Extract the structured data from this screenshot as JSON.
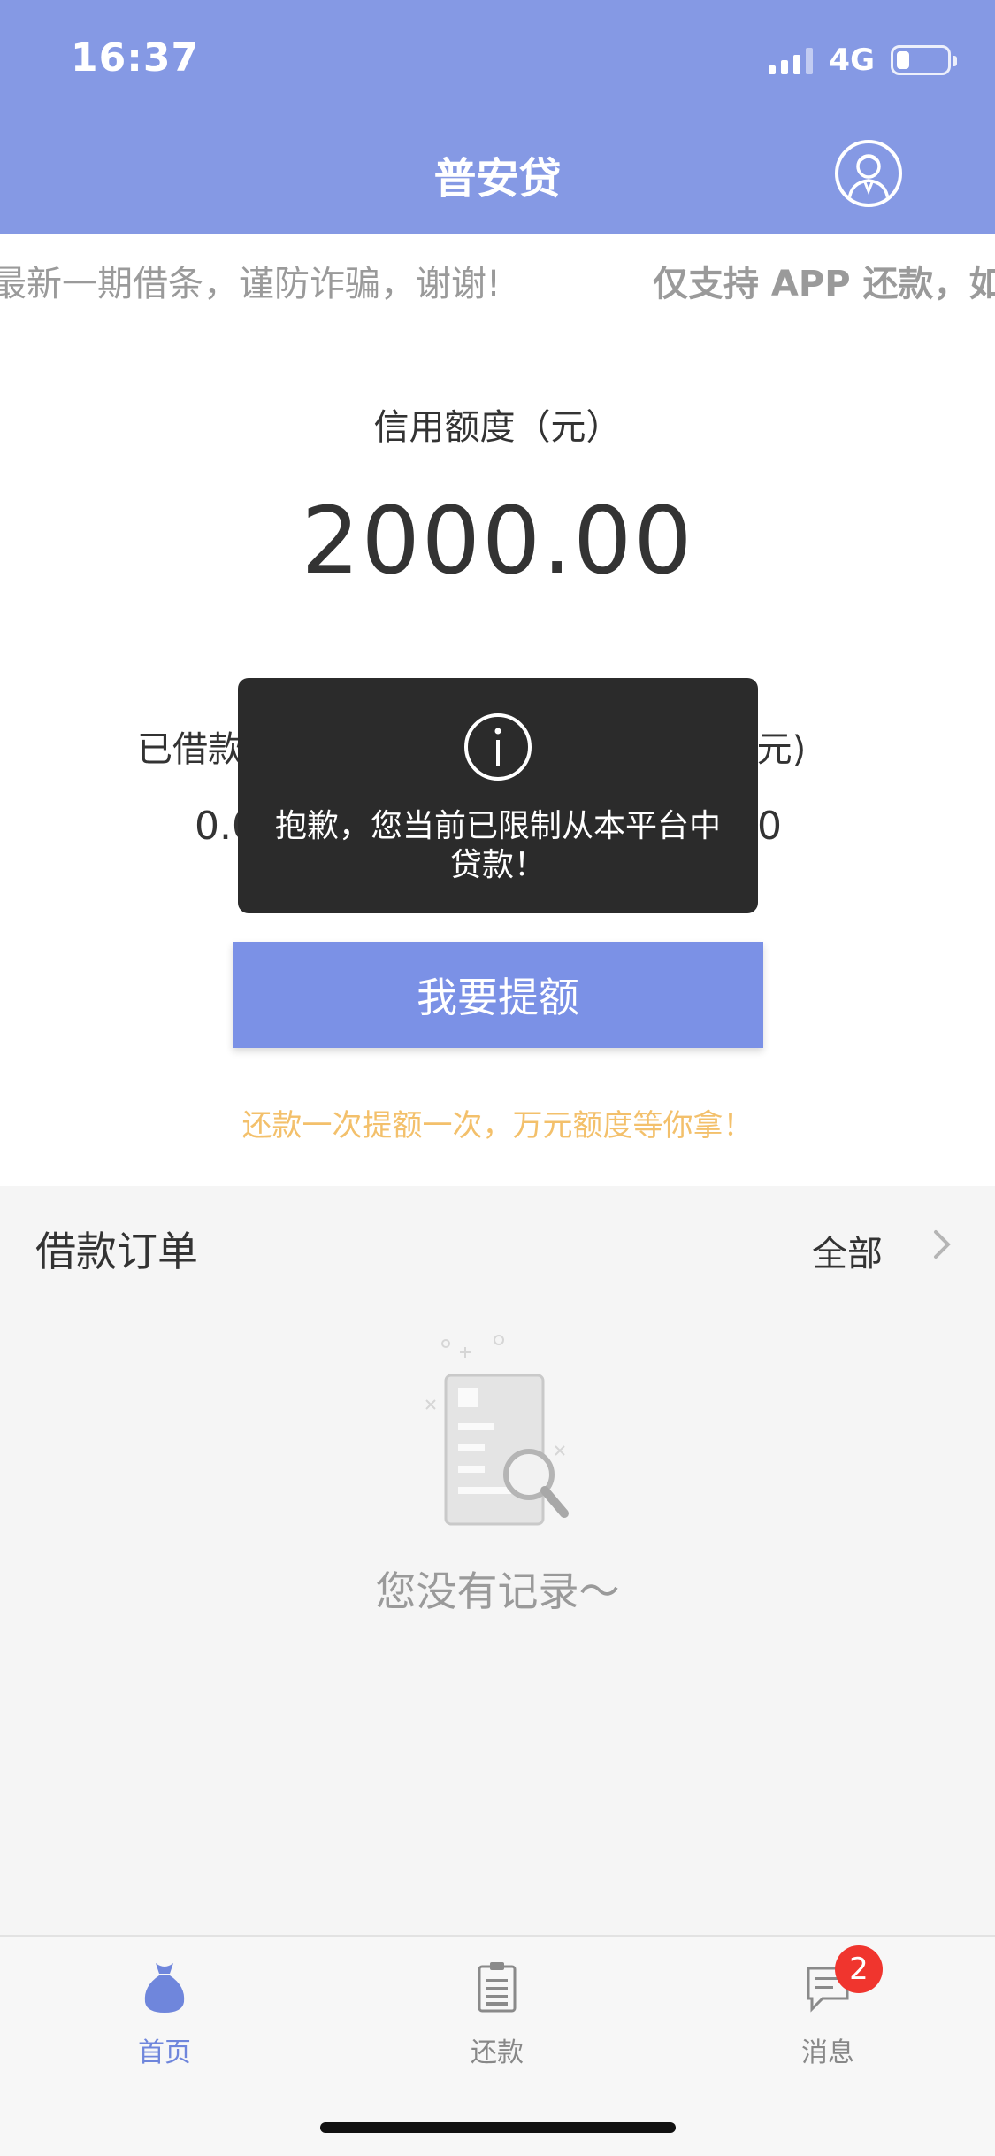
{
  "status_bar": {
    "time": "16:37",
    "network": "4G"
  },
  "header": {
    "title": "普安贷"
  },
  "marquee": {
    "text_1": "最新一期借条，谨防诈骗，谢谢!",
    "text_2": "仅支持 APP 还款，如"
  },
  "credit": {
    "label": "信用额度（元）",
    "amount": "2000.00",
    "borrowed_label": "已借款",
    "borrowed_value": "0.0",
    "right_label": "(元)",
    "right_value": "0",
    "raise_button": "我要提额",
    "promo": "还款一次提额一次，万元额度等你拿！"
  },
  "toast": {
    "message": "抱歉，您当前已限制从本平台中贷款！"
  },
  "orders": {
    "title": "借款订单",
    "all_label": "全部",
    "empty_text": "您没有记录～"
  },
  "tabbar": {
    "tabs": [
      {
        "label": "首页",
        "icon": "money-bag-icon",
        "active": true
      },
      {
        "label": "还款",
        "icon": "clipboard-icon",
        "active": false
      },
      {
        "label": "消息",
        "icon": "message-icon",
        "active": false
      }
    ],
    "message_badge": "2"
  },
  "colors": {
    "header_bg": "#8599e4",
    "button_bg": "#7b91e6",
    "promo_text": "#f3c06b",
    "active_tab": "#6f86dc",
    "badge": "#f0352e"
  }
}
